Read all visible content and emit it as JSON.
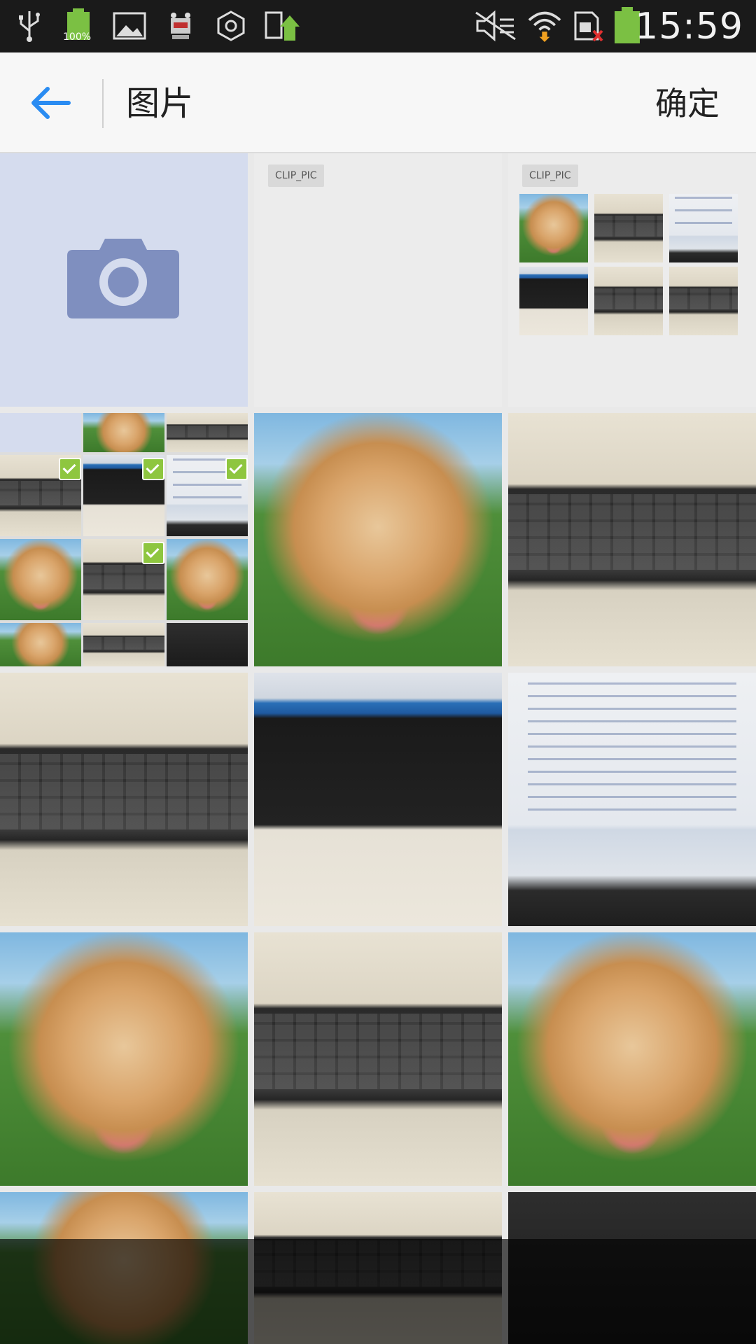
{
  "status_bar": {
    "battery_label": "100%",
    "time": "15:59",
    "icons": [
      "usb-icon",
      "battery-icon",
      "image-icon",
      "robot-icon",
      "hexagon-icon",
      "app-update-icon",
      "mute-icon",
      "wifi-icon",
      "sim-icon",
      "battery-full-icon"
    ]
  },
  "app_bar": {
    "title": "图片",
    "confirm_label": "确定"
  },
  "albums": [
    {
      "label": "CLIP_PIC"
    },
    {
      "label": "CLIP_PIC"
    }
  ],
  "colors": {
    "accent": "#2a8cf2",
    "check_green": "#8ec63f",
    "camera_tile": "#d5dcee",
    "camera_icon": "#7f8fbf"
  }
}
